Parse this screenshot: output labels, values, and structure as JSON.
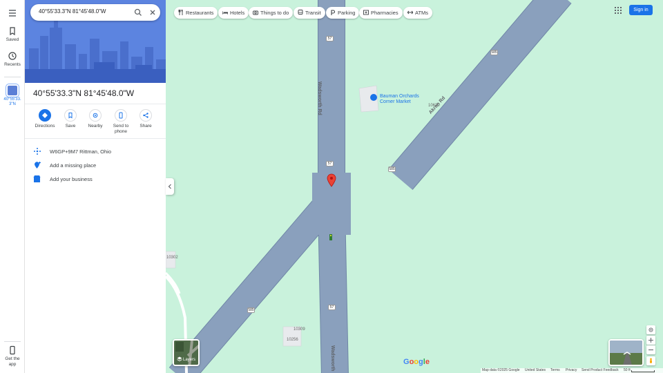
{
  "search": {
    "value": "40°55'33.3\"N 81°45'48.0\"W"
  },
  "rail": {
    "saved_label": "Saved",
    "recents_label": "Recents",
    "recent_item_label": "40°55'33.3\"N",
    "get_app_label": "Get the app"
  },
  "place": {
    "title": "40°55'33.3\"N 81°45'48.0\"W",
    "actions": [
      {
        "label": "Directions",
        "icon": "directions-icon"
      },
      {
        "label": "Save",
        "icon": "bookmark-icon"
      },
      {
        "label": "Nearby",
        "icon": "nearby-icon"
      },
      {
        "label": "Send to phone",
        "icon": "phone-icon"
      },
      {
        "label": "Share",
        "icon": "share-icon"
      }
    ],
    "plus_code": "W6GP+9M7 Rittman, Ohio",
    "add_place": "Add a missing place",
    "add_business": "Add your business"
  },
  "chips": [
    {
      "label": "Restaurants",
      "icon": "restaurant-icon"
    },
    {
      "label": "Hotels",
      "icon": "hotel-icon"
    },
    {
      "label": "Things to do",
      "icon": "camera-icon"
    },
    {
      "label": "Transit",
      "icon": "transit-icon"
    },
    {
      "label": "Parking",
      "icon": "parking-icon"
    },
    {
      "label": "Pharmacies",
      "icon": "pharmacy-icon"
    },
    {
      "label": "ATMs",
      "icon": "atm-icon"
    }
  ],
  "header": {
    "signin_label": "Sign in"
  },
  "map": {
    "roads": {
      "wadsworth_rd": "Wadsworth Rd",
      "akron_rd": "Akron Rd",
      "wadsworth_bottom": "Wadsworth"
    },
    "shields": [
      "57",
      "585",
      "57",
      "585",
      "585",
      "57"
    ],
    "poi": "Bauman Orchards Corner Market",
    "house_numbers": [
      "10630",
      "10302",
      "10309",
      "10256"
    ],
    "layers_label": "Layers",
    "colors": {
      "land": "#c9f2dc",
      "road": "#8aa0bd",
      "road_edge": "#6f86a6",
      "pin": "#ea4335"
    }
  },
  "footer": {
    "map_data": "Map data ©2025 Google",
    "country": "United States",
    "terms": "Terms",
    "privacy": "Privacy",
    "feedback": "Send Product Feedback",
    "scale": "50 ft"
  }
}
